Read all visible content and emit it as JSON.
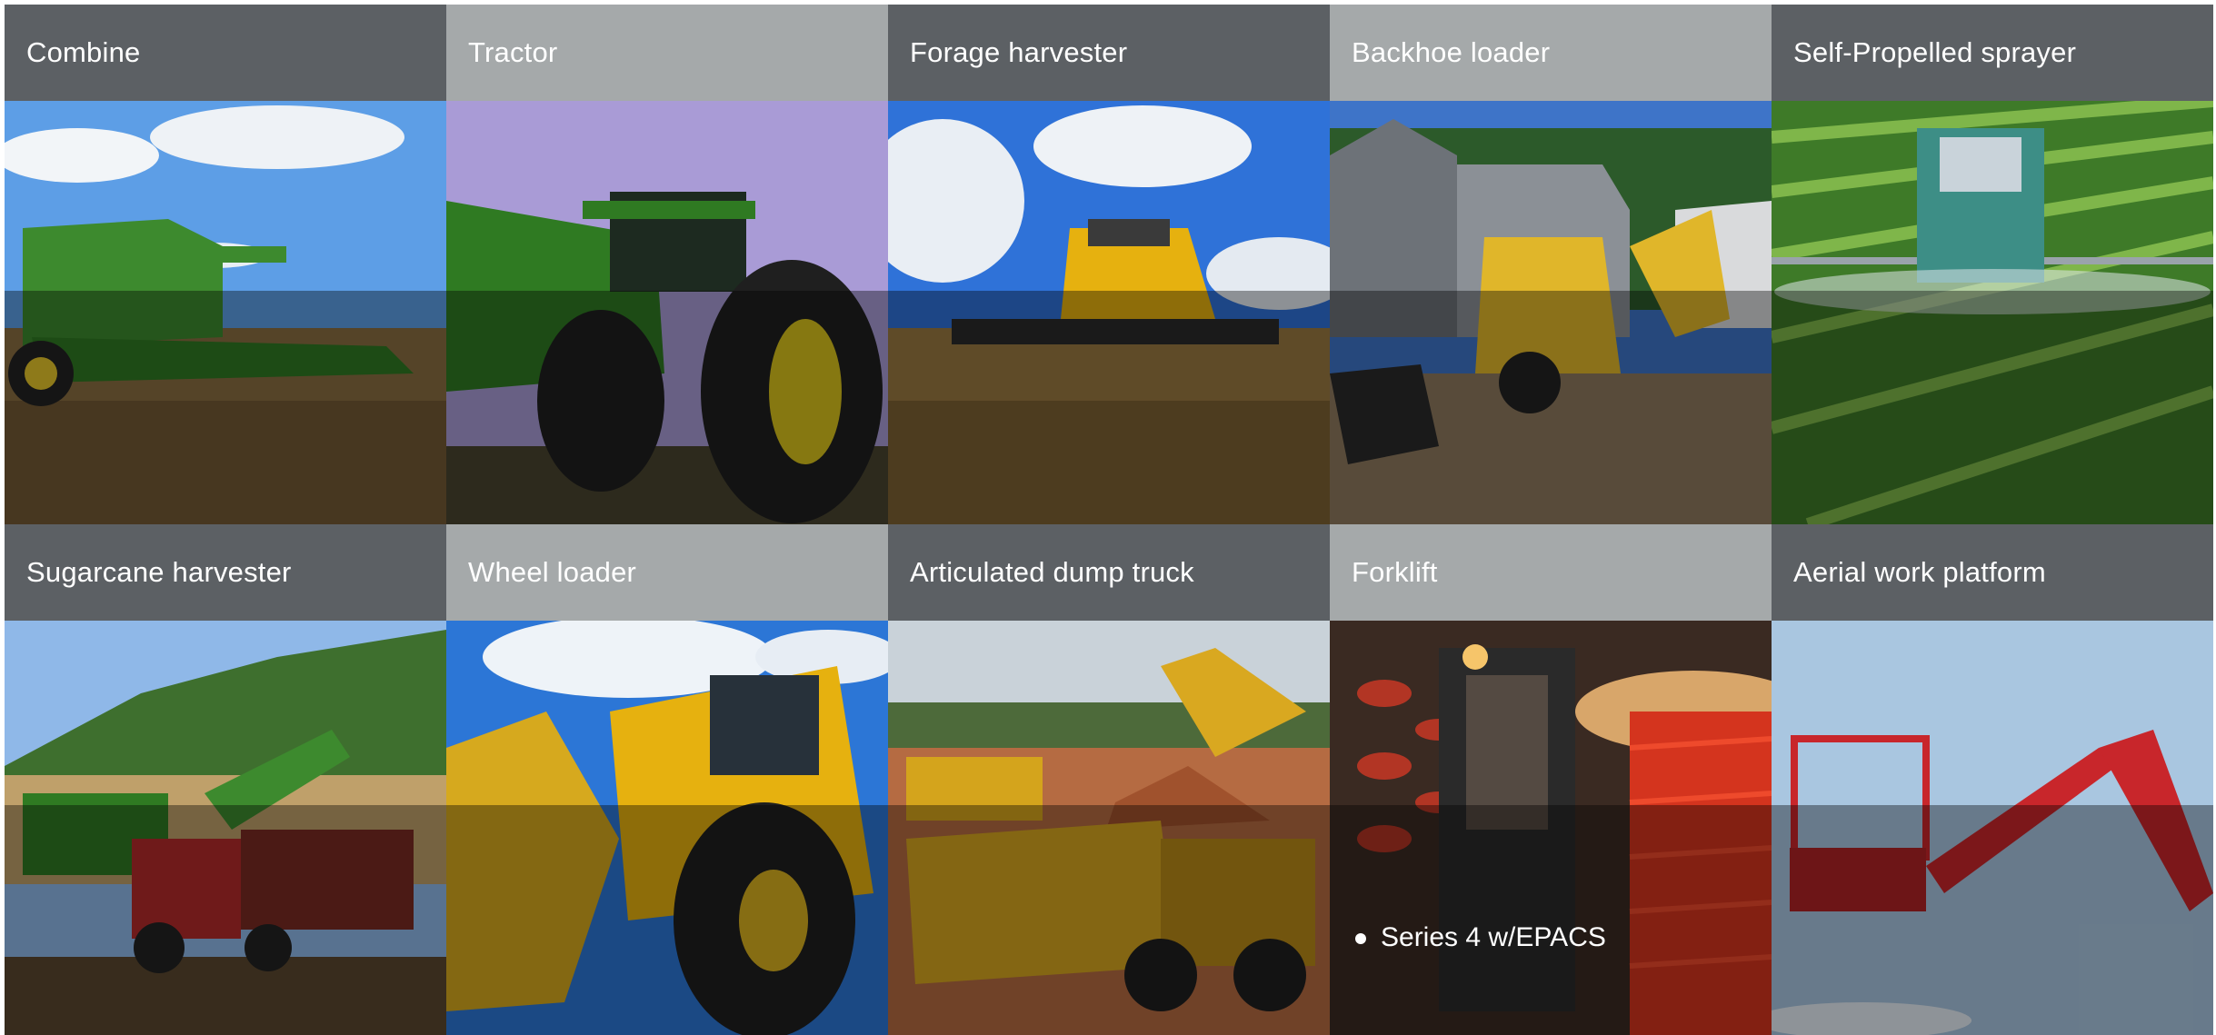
{
  "tiles": [
    {
      "label": "Combine"
    },
    {
      "label": "Tractor"
    },
    {
      "label": "Forage harvester"
    },
    {
      "label": "Backhoe loader"
    },
    {
      "label": "Self-Propelled sprayer"
    },
    {
      "label": "Sugarcane harvester"
    },
    {
      "label": "Wheel loader"
    },
    {
      "label": "Articulated dump truck"
    },
    {
      "label": "Forklift",
      "bullets": [
        "Series 4 w/EPACS"
      ]
    },
    {
      "label": "Aerial work platform"
    }
  ],
  "colors": {
    "header_dark": "#5c6064",
    "header_light": "#a5a9aa",
    "machine_green": "#3d8a2e",
    "machine_yellow": "#e6b10f",
    "machine_red": "#c8262b"
  }
}
